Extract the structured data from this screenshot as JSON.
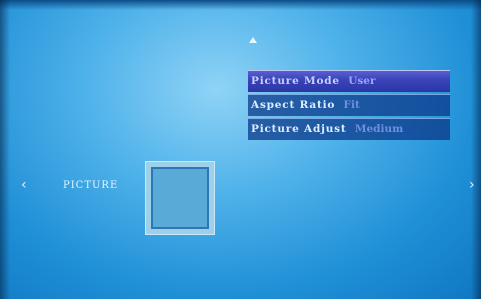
{
  "menu": {
    "items": [
      {
        "label": "Picture Mode",
        "value": "User",
        "selected": true
      },
      {
        "label": "Aspect Ratio",
        "value": "Fit",
        "selected": false
      },
      {
        "label": "Picture Adjust",
        "value": "Medium",
        "selected": false
      }
    ]
  },
  "section": {
    "label": "PICTURE"
  },
  "navigation": {
    "left": "‹",
    "right": "›"
  },
  "icons": {
    "scroll_up": "up-arrow-icon",
    "tile": "picture-icon"
  },
  "colors": {
    "background": "#4fb2ea",
    "selected_row": "#3b44b8",
    "row": "#0a3487"
  }
}
